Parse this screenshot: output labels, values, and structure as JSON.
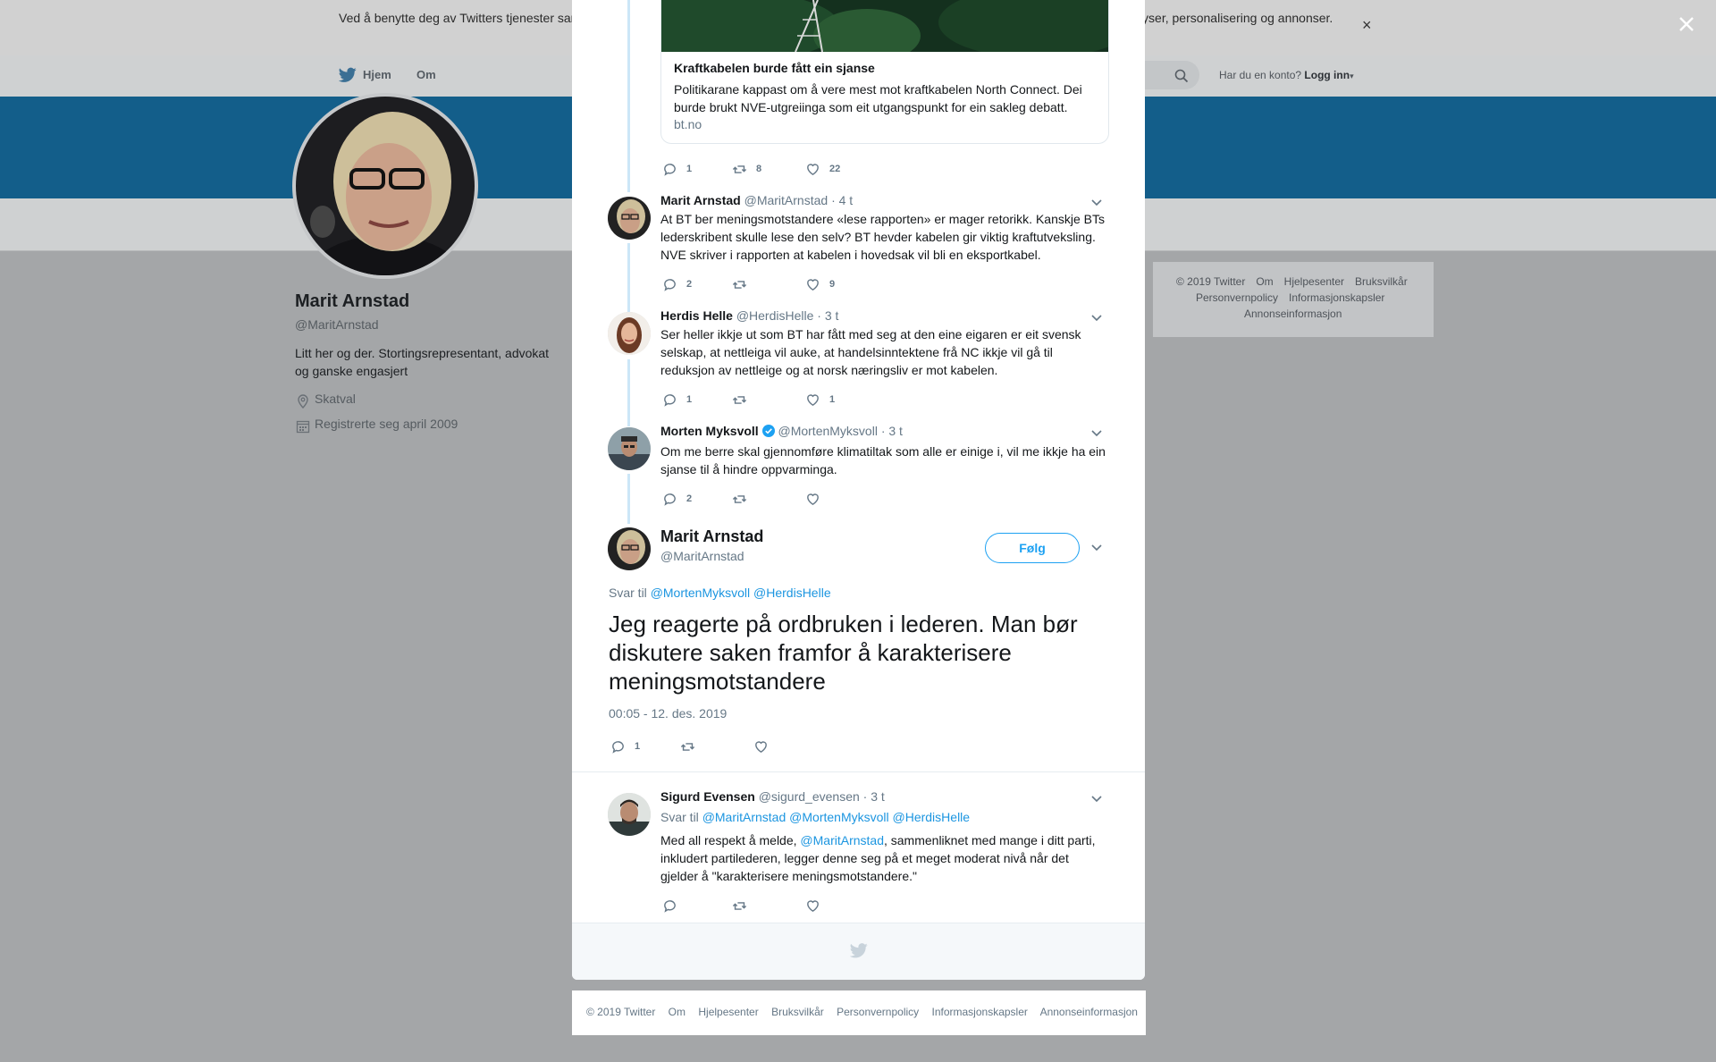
{
  "cookie_banner": {
    "text": "Ved å benytte deg av Twitters tjenester samtykker du i bruken av informasjonskapsler. Twitter og partnere bruker informasjonskapsler til bl.a. analyser, personalisering og annonser.",
    "close_symbol": "×"
  },
  "topnav": {
    "home": "Hjem",
    "about": "Om",
    "account_prompt": "Har du en konto?",
    "login": "Logg inn"
  },
  "profile": {
    "name": "Marit Arnstad",
    "handle": "@MaritArnstad",
    "bio": "Litt her og der. Stortingsrepresentant, advokat og ganske engasjert",
    "location": "Skatval",
    "joined": "Registrerte seg april 2009"
  },
  "right_footer": {
    "row1": [
      "© 2019 Twitter",
      "Om",
      "Hjelpesenter",
      "Bruksvilkår"
    ],
    "row2": [
      "Personvernpolicy",
      "Informasjonskapsler"
    ],
    "row3": [
      "Annonseinformasjon"
    ]
  },
  "link_card": {
    "title": "Kraftkabelen burde fått ein sjanse",
    "description": "Politikarane kappast om å vere mest mot kraftkabelen North Connect. Dei burde brukt NVE-utgreiinga som eit utgangspunkt for ein sakleg debatt.",
    "domain": "bt.no",
    "replies": "1",
    "retweets": "8",
    "likes": "22"
  },
  "tweets": [
    {
      "name": "Marit Arnstad",
      "handle": "@MaritArnstad",
      "time": "· 4 t",
      "text": "At BT ber meningsmotstandere «lese rapporten» er mager retorikk. Kanskje BTs lederskribent skulle lese den selv? BT hevder kabelen gir viktig kraftutveksling. NVE skriver i rapporten at kabelen i hovedsak vil bli en eksportkabel.",
      "replies": "2",
      "retweets": "",
      "likes": "9"
    },
    {
      "name": "Herdis Helle",
      "handle": "@HerdisHelle",
      "time": "· 3 t",
      "text": "Ser heller ikkje ut som BT har fått med seg at den eine eigaren er eit svensk selskap, at nettleiga vil auke, at handelsinntektene frå NC ikkje vil gå til reduksjon av nettleige og at norsk næringsliv er mot kabelen.",
      "replies": "1",
      "retweets": "",
      "likes": "1"
    },
    {
      "name": "Morten Myksvoll",
      "handle": "@MortenMyksvoll",
      "time": "· 3 t",
      "text": "Om me berre skal gjennomføre klimatiltak som alle er einige i, vil me ikkje ha ein sjanse til å hindre oppvarminga.",
      "replies": "2",
      "retweets": "",
      "likes": ""
    }
  ],
  "main_tweet": {
    "name": "Marit Arnstad",
    "handle": "@MaritArnstad",
    "follow": "Følg",
    "reply_to_label": "Svar til",
    "reply_to_1": "@MortenMyksvoll",
    "reply_to_2": "@HerdisHelle",
    "text": "Jeg reagerte på ordbruken i lederen. Man bør diskutere saken framfor å karakterisere meningsmotstandere",
    "timestamp": "00:05 - 12. des. 2019",
    "replies": "1"
  },
  "reply_tweet": {
    "name": "Sigurd Evensen",
    "handle": "@sigurd_evensen",
    "time": "· 3 t",
    "reply_to_label": "Svar til",
    "reply_to_1": "@MaritArnstad",
    "reply_to_2": "@MortenMyksvoll",
    "reply_to_3": "@HerdisHelle",
    "text_before": "Med all respekt å melde, ",
    "mention": "@MaritArnstad",
    "text_after": ", sammenliknet med mange i ditt parti, inkludert partilederen, legger denne seg på et meget moderat nivå når det gjelder å \"karakterisere meningsmotstandere.\""
  },
  "bottom_footer": [
    "© 2019 Twitter",
    "Om",
    "Hjelpesenter",
    "Bruksvilkår",
    "Personvernpolicy",
    "Informasjonskapsler",
    "Annonseinformasjon"
  ],
  "colors": {
    "link": "#1b95e0",
    "banner": "#135e8a",
    "overlay_bg": "#a4a6a8"
  }
}
